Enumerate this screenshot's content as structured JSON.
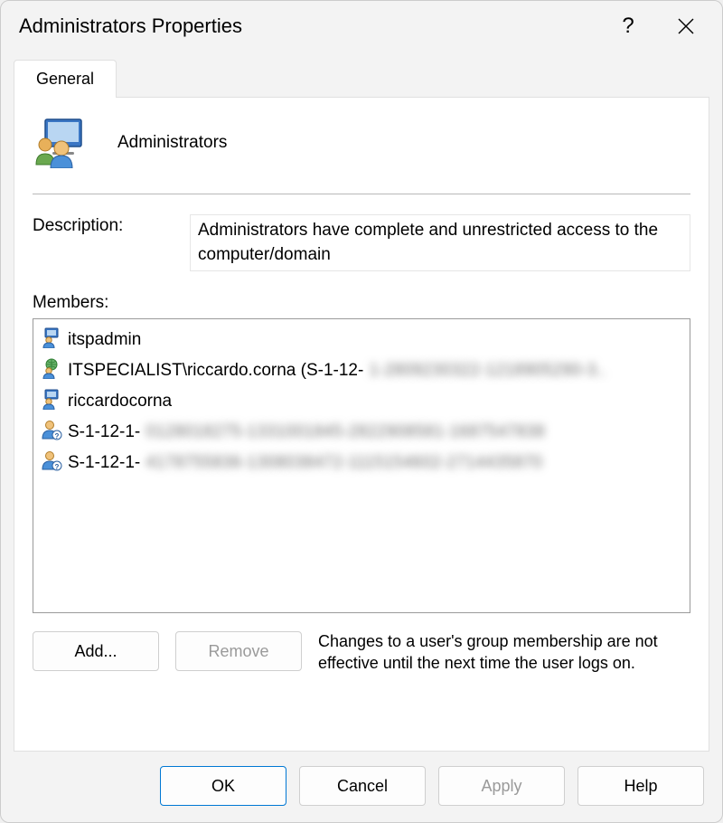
{
  "window": {
    "title": "Administrators Properties"
  },
  "tabs": {
    "general": "General"
  },
  "group": {
    "name": "Administrators"
  },
  "description": {
    "label": "Description:",
    "value": "Administrators have complete and unrestricted access to the computer/domain"
  },
  "members": {
    "label": "Members:",
    "items": [
      {
        "icon": "user-local",
        "display": "itspadmin",
        "blurred_suffix": ""
      },
      {
        "icon": "user-domain",
        "display": "ITSPECIALIST\\riccardo.corna (S-1-12-",
        "blurred_suffix": "1-2809230322-1218905290-3.."
      },
      {
        "icon": "user-local",
        "display": "riccardocorna",
        "blurred_suffix": ""
      },
      {
        "icon": "user-unknown",
        "display": "S-1-12-1-",
        "blurred_suffix": "0128018275-1331001845-2822908581-1687547838"
      },
      {
        "icon": "user-unknown",
        "display": "S-1-12-1-",
        "blurred_suffix": "4178755836-1308038472-1115154602-2714435870"
      }
    ]
  },
  "actions": {
    "add": "Add...",
    "remove": "Remove",
    "note": "Changes to a user's group membership are not effective until the next time the user logs on."
  },
  "footer": {
    "ok": "OK",
    "cancel": "Cancel",
    "apply": "Apply",
    "help": "Help"
  }
}
